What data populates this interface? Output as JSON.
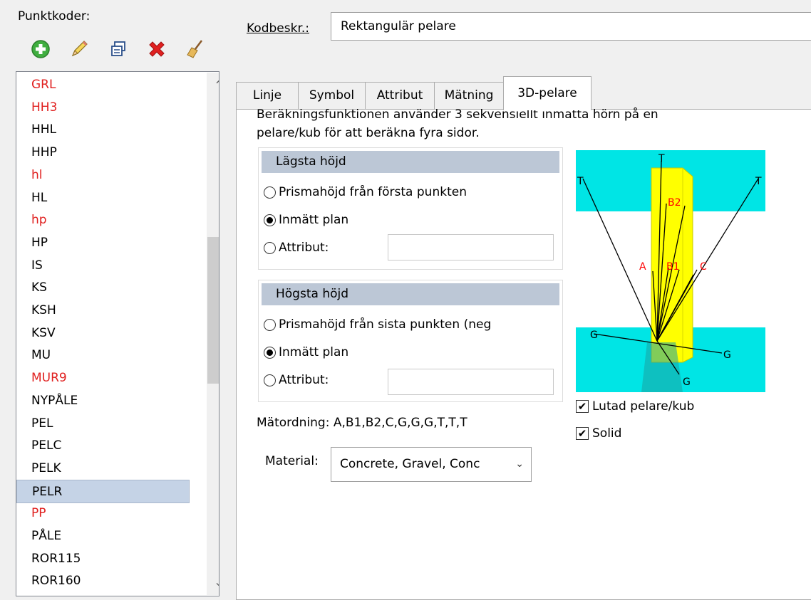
{
  "left_pane": {
    "label": "Punktkoder:",
    "toolbar": {
      "add_icon": "add-icon",
      "edit_icon": "pencil-icon",
      "copy_icon": "copy-icon",
      "delete_icon": "delete-icon",
      "clean_icon": "broom-icon"
    },
    "items": [
      {
        "label": "GRL",
        "color": "red"
      },
      {
        "label": "HH3",
        "color": "red"
      },
      {
        "label": "HHL",
        "color": "black"
      },
      {
        "label": "HHP",
        "color": "black"
      },
      {
        "label": "hl",
        "color": "red"
      },
      {
        "label": "HL",
        "color": "black"
      },
      {
        "label": "hp",
        "color": "red"
      },
      {
        "label": "HP",
        "color": "black"
      },
      {
        "label": "IS",
        "color": "black"
      },
      {
        "label": "KS",
        "color": "black"
      },
      {
        "label": "KSH",
        "color": "black"
      },
      {
        "label": "KSV",
        "color": "black"
      },
      {
        "label": "MU",
        "color": "black"
      },
      {
        "label": "MUR9",
        "color": "red"
      },
      {
        "label": "NYPÅLE",
        "color": "black"
      },
      {
        "label": "PEL",
        "color": "black"
      },
      {
        "label": "PELC",
        "color": "black"
      },
      {
        "label": "PELK",
        "color": "black"
      },
      {
        "label": "PELR",
        "color": "black",
        "selected": true
      },
      {
        "label": "PP",
        "color": "red"
      },
      {
        "label": "PÅLE",
        "color": "black"
      },
      {
        "label": "ROR115",
        "color": "black"
      },
      {
        "label": "ROR160",
        "color": "black"
      }
    ]
  },
  "header": {
    "kodbeskr_label": "Kodbeskr.:",
    "kodbeskr_value": "Rektangulär pelare"
  },
  "tabs": [
    "Linje",
    "Symbol",
    "Attribut",
    "Mätning",
    "3D-pelare"
  ],
  "active_tab": "3D-pelare",
  "panel": {
    "description_line1": "Beräkningsfunktionen använder 3 sekvensiellt inmätta hörn på en",
    "description_line2": "pelare/kub för att beräkna fyra sidor.",
    "lowest": {
      "title": "Lägsta höjd",
      "options": [
        "Prismahöjd från första punkten",
        "Inmätt plan",
        "Attribut:"
      ],
      "selected": 1,
      "attr_value": ""
    },
    "highest": {
      "title": "Högsta höjd",
      "options": [
        "Prismahöjd från sista punkten (neg",
        "Inmätt plan",
        "Attribut:"
      ],
      "selected": 1,
      "attr_value": ""
    },
    "order_text": "Mätordning: A,B1,B2,C,G,G,G,T,T,T",
    "material_label": "Material:",
    "material_value": "Concrete, Gravel, Conc",
    "checkboxes": [
      {
        "label": "Lutad pelare/kub",
        "checked": true
      },
      {
        "label": "Solid",
        "checked": true
      }
    ],
    "diagram_labels": {
      "t_top": "T",
      "t_left": "T",
      "t_right": "T",
      "b2": "B2",
      "a": "A",
      "b1": "B1",
      "c": "C",
      "g_left": "G",
      "g_right": "G",
      "g_bottom": "G"
    },
    "colors": {
      "sky": "#00e5e5",
      "pillar": "#ffff00",
      "label_red": "#ff0000",
      "selection": "#c5d3e6",
      "group_header": "#bcc7d6"
    }
  }
}
